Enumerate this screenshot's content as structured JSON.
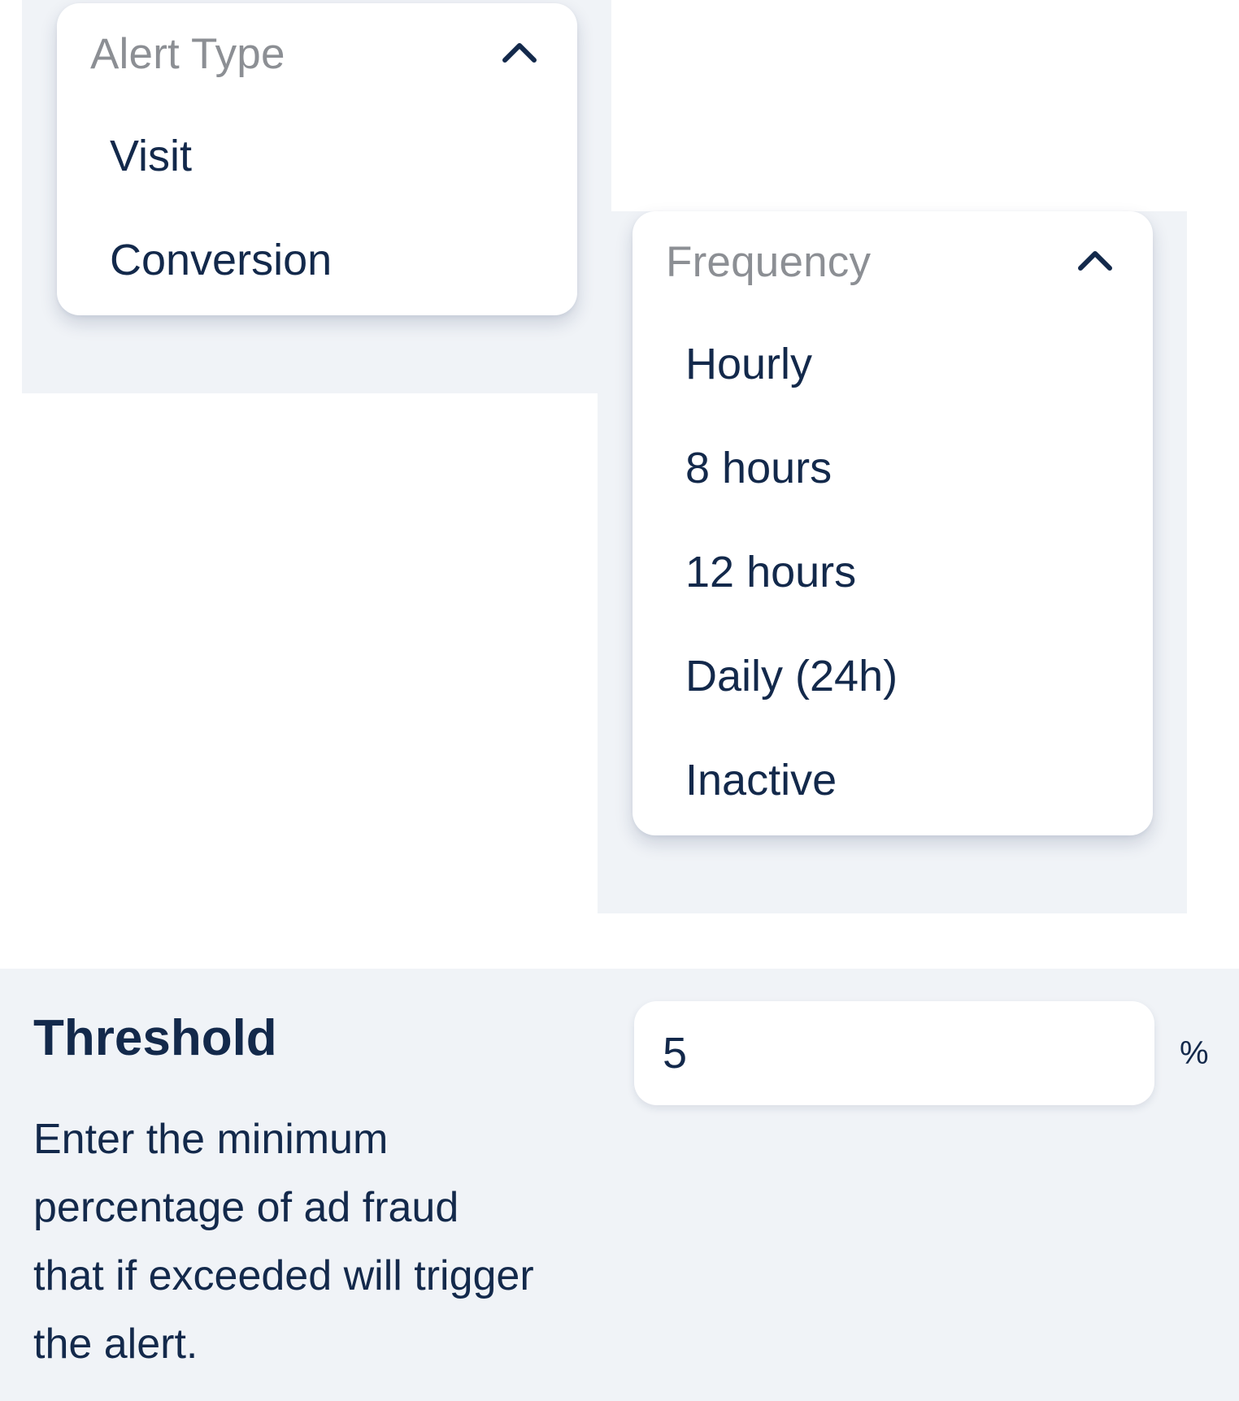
{
  "alert_type": {
    "placeholder": "Alert Type",
    "icon": "chevron-up-icon",
    "options": [
      "Visit",
      "Conversion"
    ]
  },
  "frequency": {
    "placeholder": "Frequency",
    "icon": "chevron-up-icon",
    "options": [
      "Hourly",
      "8 hours",
      "12 hours",
      "Daily (24h)",
      "Inactive"
    ]
  },
  "threshold": {
    "title": "Threshold",
    "description": "Enter the minimum percentage of ad fraud that if exceeded will trigger the alert.",
    "value": "5",
    "unit": "%"
  },
  "colors": {
    "text_primary": "#13294b",
    "placeholder": "#8c8f94",
    "panel_background": "#f0f3f7",
    "card_background": "#ffffff"
  }
}
